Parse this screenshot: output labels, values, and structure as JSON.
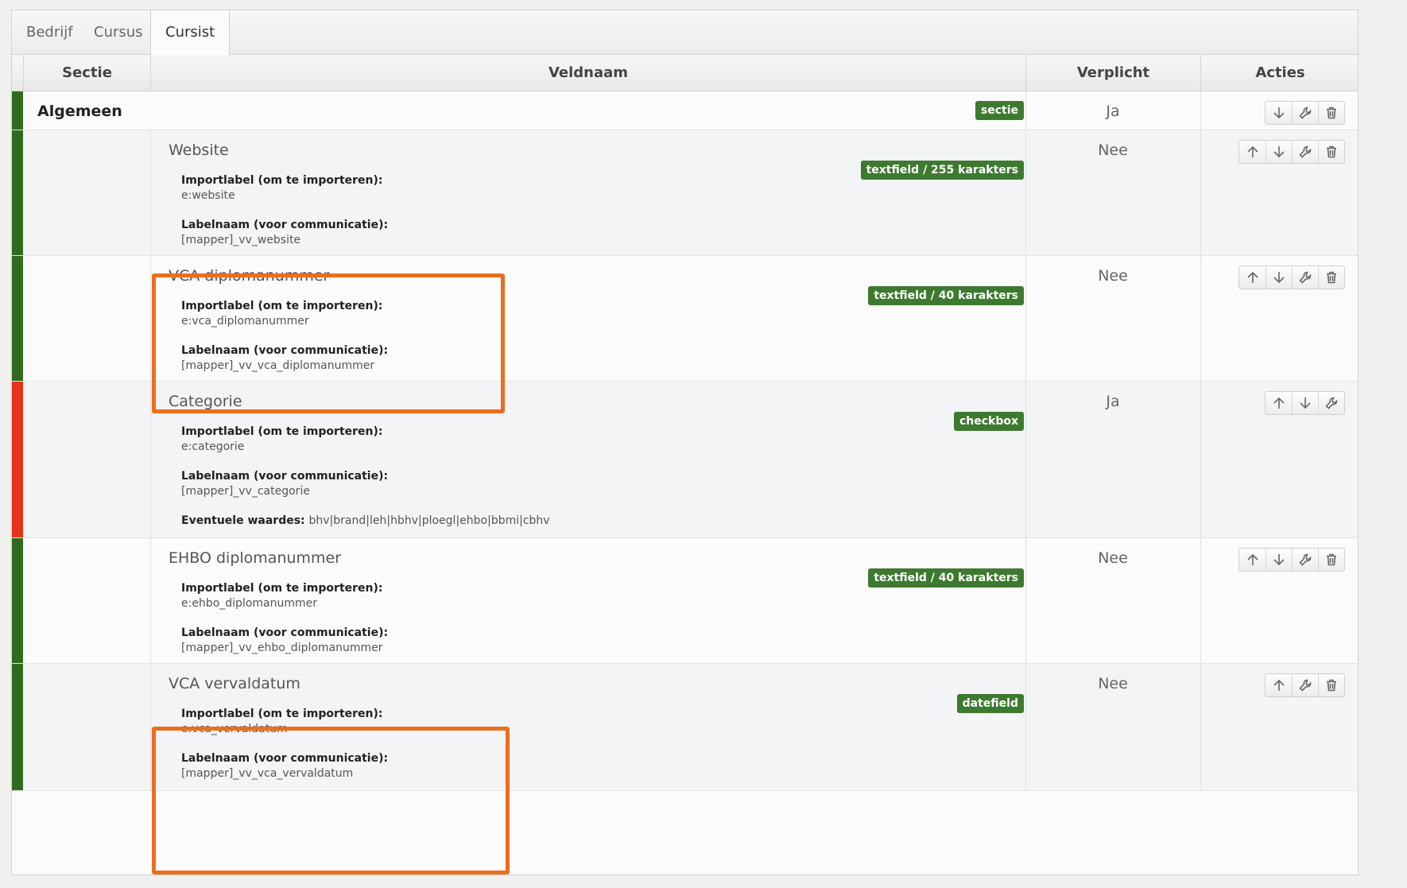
{
  "tabs": [
    {
      "label": "Bedrijf"
    },
    {
      "label": "Cursus"
    },
    {
      "label": "Cursist"
    }
  ],
  "table": {
    "headers": {
      "sectie": "Sectie",
      "veldnaam": "Veldnaam",
      "verplicht": "Verplicht",
      "acties": "Acties"
    },
    "importlabel_caption": "Importlabel (om te importeren):",
    "labelnaam_caption": "Labelnaam (voor communicatie):",
    "eventuele_caption": "Eventuele waardes:",
    "section_row": {
      "name": "Algemeen",
      "badge": "sectie",
      "required": "Ja",
      "stripe_color": "#2f6b1f"
    },
    "rows": [
      {
        "title": "Website",
        "badge": "textfield / 255 karakters",
        "importlabel": "e:website",
        "labelnaam": "[mapper]_vv_website",
        "required": "Nee",
        "stripe_color": "#2f6b1f"
      },
      {
        "title": "VCA diplomanummer",
        "badge": "textfield / 40 karakters",
        "importlabel": "e:vca_diplomanummer",
        "labelnaam": "[mapper]_vv_vca_diplomanummer",
        "required": "Nee",
        "stripe_color": "#2f6b1f"
      },
      {
        "title": "Categorie",
        "badge": "checkbox",
        "importlabel": "e:categorie",
        "labelnaam": "[mapper]_vv_categorie",
        "eventuele": "bhv|brand|leh|hbhv|ploegl|ehbo|bbmi|cbhv",
        "required": "Ja",
        "stripe_color": "#e8331c"
      },
      {
        "title": "EHBO diplomanummer",
        "badge": "textfield / 40 karakters",
        "importlabel": "e:ehbo_diplomanummer",
        "labelnaam": "[mapper]_vv_ehbo_diplomanummer",
        "required": "Nee",
        "stripe_color": "#2f6b1f"
      },
      {
        "title": "VCA vervaldatum",
        "badge": "datefield",
        "importlabel": "e:vca_vervaldatum",
        "labelnaam": "[mapper]_vv_vca_vervaldatum",
        "required": "Nee",
        "stripe_color": "#2f6b1f"
      }
    ]
  },
  "icons": {
    "up": "arrow-up-icon",
    "down": "arrow-down-icon",
    "edit": "wrench-icon",
    "delete": "trash-icon"
  },
  "colors": {
    "badge_green": "#3d7a30",
    "highlight_orange": "#ec6d20",
    "stripe_green": "#2f6b1f",
    "stripe_red": "#e8331c"
  }
}
